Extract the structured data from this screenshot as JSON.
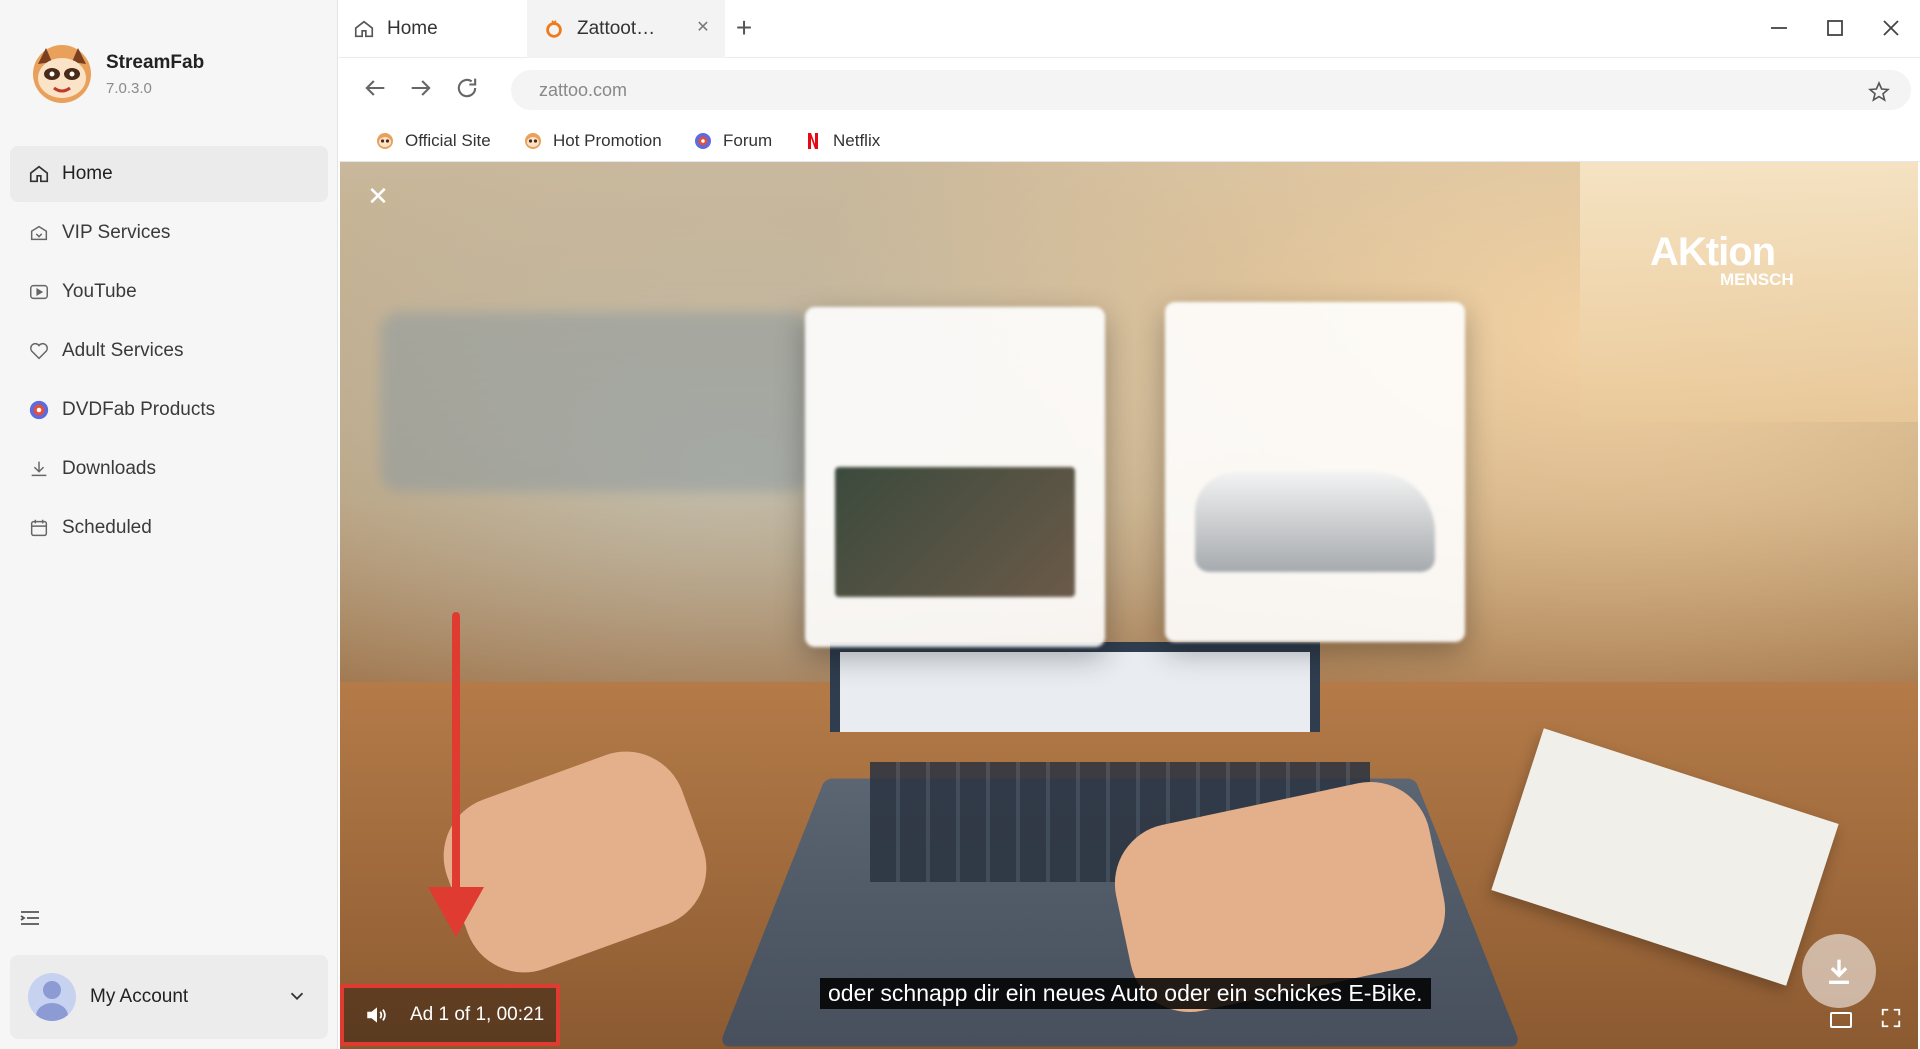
{
  "app": {
    "name": "StreamFab",
    "version": "7.0.3.0"
  },
  "sidebar": {
    "items": [
      {
        "label": "Home",
        "icon": "home-icon",
        "active": true
      },
      {
        "label": "VIP Services",
        "icon": "vip-icon"
      },
      {
        "label": "YouTube",
        "icon": "youtube-icon"
      },
      {
        "label": "Adult Services",
        "icon": "heart-icon"
      },
      {
        "label": "DVDFab Products",
        "icon": "dvdfab-icon"
      },
      {
        "label": "Downloads",
        "icon": "download-icon"
      },
      {
        "label": "Scheduled",
        "icon": "calendar-icon"
      }
    ],
    "account_label": "My Account"
  },
  "tabs": [
    {
      "label": "Home",
      "icon": "home-icon"
    },
    {
      "label": "Zattoot…",
      "icon": "zattoo-icon",
      "active": true
    }
  ],
  "address": {
    "url": "zattoo.com"
  },
  "bookmarks": [
    {
      "label": "Official Site",
      "icon": "streamfab-icon"
    },
    {
      "label": "Hot Promotion",
      "icon": "streamfab-icon"
    },
    {
      "label": "Forum",
      "icon": "forum-icon"
    },
    {
      "label": "Netflix",
      "icon": "netflix-icon"
    }
  ],
  "video": {
    "subtitle": "oder schnapp dir ein neues Auto oder ein schickes E-Bike.",
    "ad_status": "Ad 1 of 1, 00:21",
    "brand_logo": "AKtion",
    "brand_logo_sub": "MENSCH"
  },
  "colors": {
    "accent_red": "#e03b31",
    "sidebar_bg": "#f6f6f6"
  }
}
